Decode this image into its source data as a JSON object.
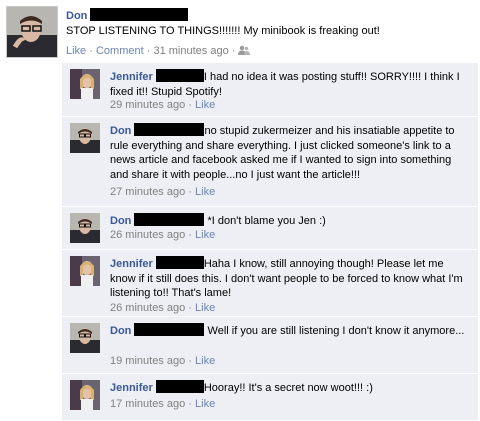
{
  "post": {
    "author": "Don",
    "message": "STOP LISTENING TO THINGS!!!!!!! My minibook is freaking out!",
    "like_label": "Like",
    "comment_label": "Comment",
    "time": "31 minutes ago",
    "sep": "·",
    "audience_icon": "friends-icon"
  },
  "comments": [
    {
      "author": "Jennifer",
      "text": "I had no idea it was posting stuff!! SORRY!!!! I think I fixed it!! Stupid Spotify!",
      "time": "29 minutes ago",
      "like_label": "Like",
      "avatar": "jennifer"
    },
    {
      "author": "Don",
      "text": "no stupid zukermeizer and his insatiable appetite to rule everything and share everything. I just clicked someone's link to a news article and facebook asked me if I wanted to sign into something and share it with people...no I just want the article!!!",
      "time": "27 minutes ago",
      "like_label": "Like",
      "avatar": "don"
    },
    {
      "author": "Don",
      "text": "*I don't blame you Jen :)",
      "time": "26 minutes ago",
      "like_label": "Like",
      "avatar": "don"
    },
    {
      "author": "Jennifer",
      "text": "Haha I know, still annoying though! Please let me know if it still does this. I don't want people to be forced to know what I'm listening to!! That's lame!",
      "time": "26 minutes ago",
      "like_label": "Like",
      "avatar": "jennifer"
    },
    {
      "author": "Don",
      "text": "Well if you are still listening I don't know it anymore...",
      "time": "19 minutes ago",
      "like_label": "Like",
      "avatar": "don"
    },
    {
      "author": "Jennifer",
      "text": "Hooray!! It's a secret now woot!!! :)",
      "time": "17 minutes ago",
      "like_label": "Like",
      "avatar": "jennifer"
    }
  ],
  "colors": {
    "link": "#3b5998",
    "comment_bg": "#edeff4",
    "meta": "#808080"
  }
}
